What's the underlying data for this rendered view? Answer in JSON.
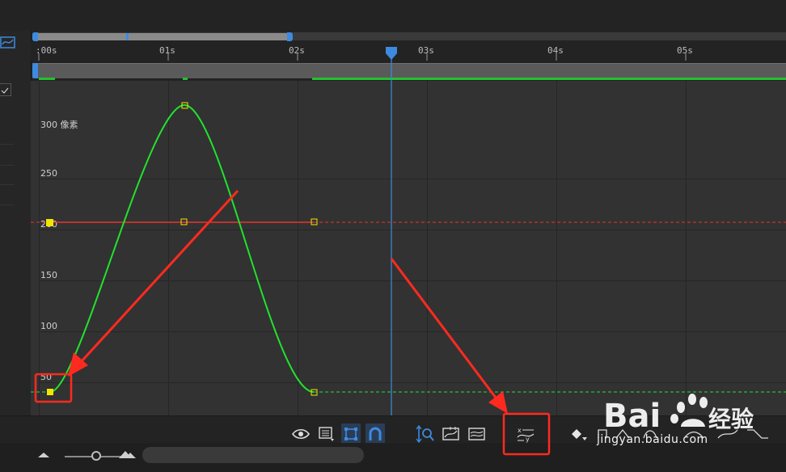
{
  "timeline": {
    "ticks": [
      ":00s",
      "01s",
      "02s",
      "03s",
      "04s",
      "05s"
    ],
    "current_time_label": "03s"
  },
  "graph": {
    "unit_label": "300 像素",
    "y_labels": [
      "250",
      "200",
      "150",
      "100",
      "50"
    ],
    "colors": {
      "green_curve": "#22e22e",
      "red_curve": "#e8342c",
      "keyframe_fill": "#f2e600",
      "playhead": "#3d8be0",
      "annotation": "#ff2a1f"
    }
  },
  "toolbar": {
    "icons": [
      "eye-icon",
      "graph-type-icon",
      "transform-box-icon",
      "snap-magnet-icon",
      "fit-selection-icon",
      "fit-all-icon",
      "graph-view-icon",
      "separate-dimensions-icon",
      "keyframe-diamond-icon"
    ]
  },
  "watermark": {
    "logo_text": "Bai 经验",
    "url": "jingyan.baidu.com"
  }
}
